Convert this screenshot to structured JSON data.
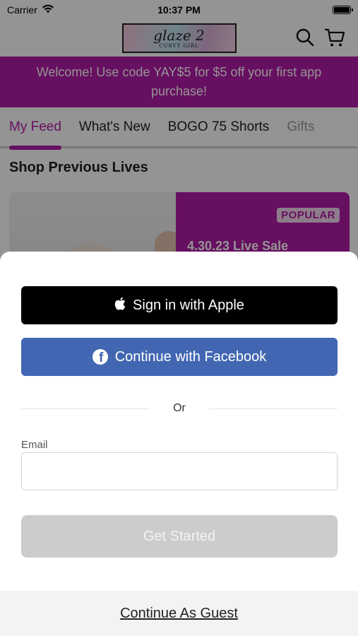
{
  "status_bar": {
    "carrier": "Carrier",
    "time": "10:37 PM"
  },
  "header": {
    "logo_main": "glaze 2",
    "logo_sub": "CURVY GIRL",
    "icons": [
      "search-icon",
      "cart-icon"
    ]
  },
  "promo": {
    "text": "Welcome! Use code YAY$5 for $5 off your first app purchase!"
  },
  "tabs": [
    {
      "label": "My Feed",
      "active": true
    },
    {
      "label": "What's New"
    },
    {
      "label": "BOGO 75 Shorts"
    },
    {
      "label": "Gifts"
    }
  ],
  "section": {
    "title": "Shop Previous Lives"
  },
  "live_card": {
    "badge": "POPULAR",
    "title": "4.30.23 Live Sale"
  },
  "sheet": {
    "apple_label": "Sign in with Apple",
    "facebook_label": "Continue with Facebook",
    "divider_text": "Or",
    "email_label": "Email",
    "email_value": "",
    "email_placeholder": "",
    "get_started_label": "Get Started",
    "guest_label": "Continue As Guest"
  },
  "colors": {
    "brand": "#b21aa8",
    "facebook": "#4267b2",
    "apple": "#000000",
    "disabled": "#cccccc"
  }
}
